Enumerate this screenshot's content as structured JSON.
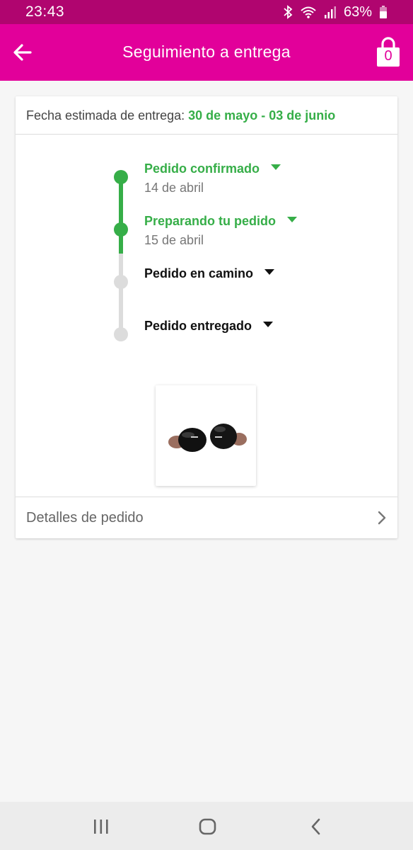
{
  "status_bar": {
    "time": "23:43",
    "battery_percent": "63%",
    "icons": [
      "bluetooth-icon",
      "wifi-icon",
      "signal-icon",
      "battery-icon"
    ]
  },
  "app_bar": {
    "title": "Seguimiento a entrega",
    "back_icon": "arrow-left-icon",
    "cart_icon": "shopping-bag-icon",
    "cart_count": "0",
    "background": "#e2009a"
  },
  "delivery": {
    "eta_label": "Fecha estimada de entrega:",
    "eta_value": "30 de mayo - 03 de junio"
  },
  "timeline": {
    "steps": [
      {
        "title": "Pedido confirmado",
        "date": "14 de abril",
        "status": "done"
      },
      {
        "title": "Preparando tu pedido",
        "date": "15 de abril",
        "status": "done"
      },
      {
        "title": "Pedido en camino",
        "date": "",
        "status": "pending"
      },
      {
        "title": "Pedido entregado",
        "date": "",
        "status": "pending"
      }
    ],
    "done_color": "#36ae48",
    "pending_color": "#dcdcdc"
  },
  "product": {
    "image_icon": "earbuds-image"
  },
  "details": {
    "label": "Detalles de pedido",
    "icon": "chevron-right-icon"
  },
  "nav_bar": {
    "icons": [
      "recent-apps-icon",
      "home-icon",
      "back-icon"
    ]
  }
}
